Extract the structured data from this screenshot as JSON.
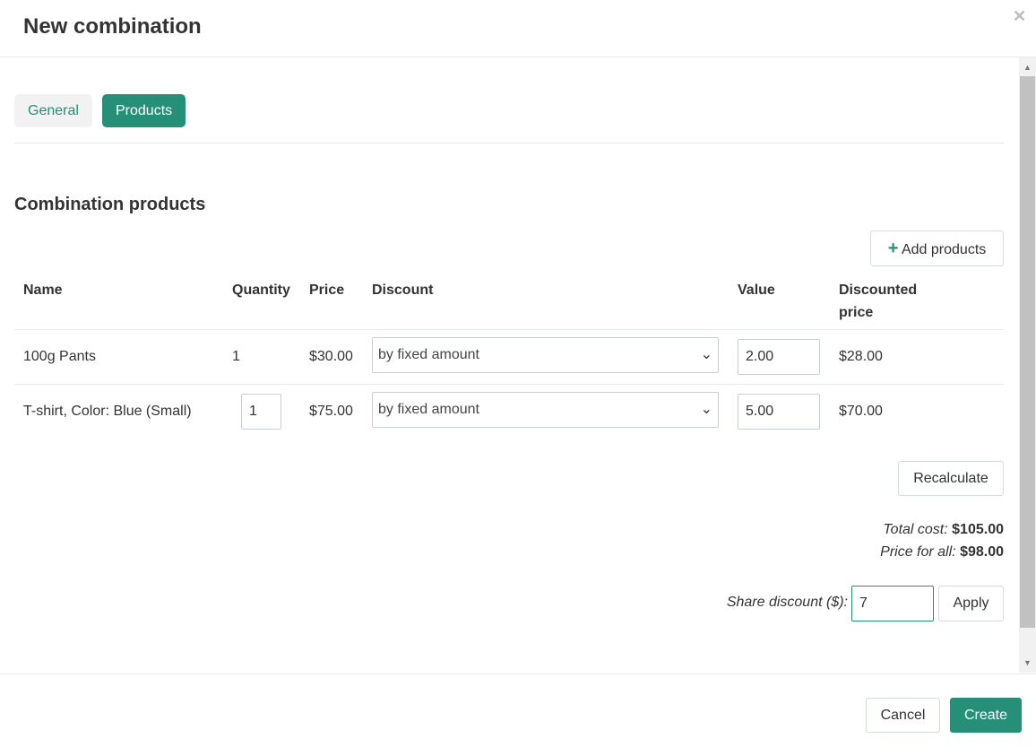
{
  "dialog": {
    "title": "New combination",
    "close_icon": "close-icon"
  },
  "tabs": [
    {
      "label": "General",
      "active": false
    },
    {
      "label": "Products",
      "active": true
    }
  ],
  "section_title": "Combination products",
  "add_products_label": "Add products",
  "columns": [
    "Name",
    "Quantity",
    "Price",
    "Discount",
    "Value",
    "Discounted price"
  ],
  "rows": [
    {
      "name": "100g Pants",
      "quantity": "1",
      "quantity_editable": false,
      "price": "$30.00",
      "discount": "by fixed amount",
      "value": "2.00",
      "discounted_price": "$28.00"
    },
    {
      "name": "T-shirt, Color: Blue (Small)",
      "quantity": "1",
      "quantity_editable": true,
      "price": "$75.00",
      "discount": "by fixed amount",
      "value": "5.00",
      "discounted_price": "$70.00"
    }
  ],
  "recalculate_label": "Recalculate",
  "totals": {
    "total_cost_label": "Total cost:",
    "total_cost": "$105.00",
    "price_for_all_label": "Price for all:",
    "price_for_all": "$98.00"
  },
  "share": {
    "label": "Share discount ($):",
    "value": "7",
    "apply_label": "Apply"
  },
  "footer": {
    "cancel_label": "Cancel",
    "create_label": "Create"
  },
  "colors": {
    "accent": "#268f78"
  }
}
